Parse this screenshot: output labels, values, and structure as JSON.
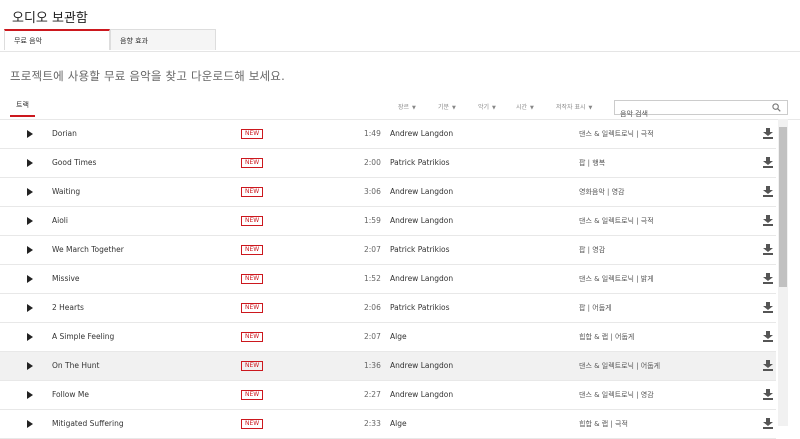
{
  "page_title": "오디오 보관함",
  "tabs": [
    {
      "label": "무료 음악"
    },
    {
      "label": "음향 효과"
    }
  ],
  "intro_text": "프로젝트에 사용할 무료 음악을 찾고 다운로드해 보세요.",
  "toolbar": {
    "track_tab_label": "트랙",
    "filters": [
      {
        "label": "장르"
      },
      {
        "label": "기분"
      },
      {
        "label": "악기"
      },
      {
        "label": "시간"
      },
      {
        "label": "저작자 표시"
      }
    ],
    "search_placeholder": "음악 검색"
  },
  "tracks": [
    {
      "title": "Dorian",
      "badge": "NEW",
      "duration": "1:49",
      "artist": "Andrew Langdon",
      "genre": "댄스 & 일렉트로닉 | 극적"
    },
    {
      "title": "Good Times",
      "badge": "NEW",
      "duration": "2:00",
      "artist": "Patrick Patrikios",
      "genre": "팝 | 행복"
    },
    {
      "title": "Waiting",
      "badge": "NEW",
      "duration": "3:06",
      "artist": "Andrew Langdon",
      "genre": "영화음악 | 영감"
    },
    {
      "title": "Aioli",
      "badge": "NEW",
      "duration": "1:59",
      "artist": "Andrew Langdon",
      "genre": "댄스 & 일렉트로닉 | 극적"
    },
    {
      "title": "We March Together",
      "badge": "NEW",
      "duration": "2:07",
      "artist": "Patrick Patrikios",
      "genre": "팝 | 영감"
    },
    {
      "title": "Missive",
      "badge": "NEW",
      "duration": "1:52",
      "artist": "Andrew Langdon",
      "genre": "댄스 & 일렉트로닉 | 밝게"
    },
    {
      "title": "2 Hearts",
      "badge": "NEW",
      "duration": "2:06",
      "artist": "Patrick Patrikios",
      "genre": "팝 | 어둡게"
    },
    {
      "title": "A Simple Feeling",
      "badge": "NEW",
      "duration": "2:07",
      "artist": "Alge",
      "genre": "힙합 & 랩 | 어둡게"
    },
    {
      "title": "On The Hunt",
      "badge": "NEW",
      "duration": "1:36",
      "artist": "Andrew Langdon",
      "genre": "댄스 & 일렉트로닉 | 어둡게"
    },
    {
      "title": "Follow Me",
      "badge": "NEW",
      "duration": "2:27",
      "artist": "Andrew Langdon",
      "genre": "댄스 & 일렉트로닉 | 영감"
    },
    {
      "title": "Mitigated Suffering",
      "badge": "NEW",
      "duration": "2:33",
      "artist": "Alge",
      "genre": "힙합 & 랩 | 극적"
    }
  ],
  "colors": {
    "accent": "#cc181e"
  }
}
